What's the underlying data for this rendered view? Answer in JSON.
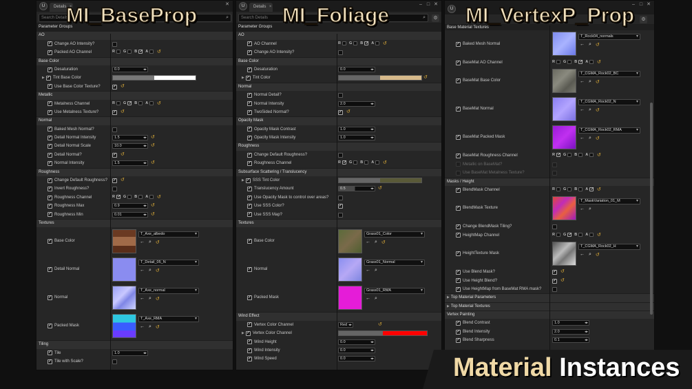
{
  "overlays": {
    "p1": "MI_BaseProp",
    "p2": "MI_Foliage",
    "p3": "MI_VertexP_Prop",
    "banner_w1": "Material",
    "banner_w2": "Instances"
  },
  "chrome": {
    "tab": "Details",
    "search": "Search Details",
    "ue": "U",
    "close": "×",
    "min": "–",
    "max": "□",
    "x": "✕"
  },
  "icons": {
    "search": "⌕",
    "gear": "⚙",
    "arrow": "←",
    "browse": "⌕",
    "reset": "↺",
    "tri": "▶",
    "check": "✓"
  },
  "channels": {
    "r": "R",
    "g": "G",
    "b": "B",
    "a": "A"
  },
  "p1": {
    "header": "Parameter Groups",
    "s_ao": "AO",
    "ao1": "Change AO Intensity?",
    "ao2": "Packed AO Channel",
    "s_bc": "Base Color",
    "bc1": "Desaturation",
    "bc1v": "0.0",
    "bc2": "Tint Base Color",
    "bc3": "Use Base Color Texture?",
    "s_met": "Metallic",
    "met1": "Metalness Channel",
    "met2": "Use Metalness Texture?",
    "s_nor": "Normal",
    "n1": "Baked Mesh Normal?",
    "n2": "Detail Normal Intensity",
    "n2v": "1.5",
    "n3": "Detail Normal Scale",
    "n3v": "10.0",
    "n4": "Detail Normal?",
    "n5": "Normal Intensity",
    "n5v": "1.5",
    "s_rough": "Roughness",
    "r1": "Change Default Roughness?",
    "r2": "Invert Roughness?",
    "r3": "Roughness Channel",
    "r4": "Roughness Max",
    "r4v": "0.9",
    "r5": "Roughness Min",
    "r5v": "0.01",
    "s_tex": "Textures",
    "t1": "Base Color",
    "t1v": "T_Axe_albedo",
    "t2": "Detail Normal",
    "t2v": "T_Detail_05_N",
    "t3": "Normal",
    "t3v": "T_Axe_normal",
    "t4": "Packed Mask",
    "t4v": "T_Axe_RMA",
    "s_til": "Tiling",
    "til1": "Tile",
    "til1v": "1.0",
    "til2": "Tile with Scale?"
  },
  "p2": {
    "header": "Parameter Groups",
    "s_ao": "AO",
    "ao1": "AO Channel",
    "ao2": "Change AO Intensity?",
    "s_bc": "Base Color",
    "bc1": "Desaturation",
    "bc1v": "0.0",
    "bc2": "Tint Color",
    "s_nor": "Normal",
    "n1": "Normal Detail?",
    "n2": "Normal Intensity",
    "n2v": "2.0",
    "n3": "TwoSided Normal?",
    "s_om": "Opacity Mask",
    "om1": "Opacity Mask Contrast",
    "om1v": "1.0",
    "om2": "Opacity Mask Intensity",
    "om2v": "1.0",
    "s_rough": "Roughness",
    "r1": "Change Default Roughness?",
    "r2": "Roughness Channel",
    "s_sss": "Subsurface Scattering / Translucency",
    "sss1": "SSS Tint Color",
    "sss2": "Translucency Amount",
    "sss2v": "0.5",
    "sss3": "Use Opacity Mask to control over areas?",
    "sss4": "Use SSS Color?",
    "sss5": "Use SSS Map?",
    "s_tex": "Textures",
    "t1": "Base Color",
    "t1v": "Grass01_Color",
    "t2": "Normal",
    "t2v": "Grass01_Normal",
    "t3": "Packed Mask",
    "t3v": "Grass01_RMA",
    "s_wind": "Wind Effect",
    "w1": "Vertex Color Channel",
    "w1v": "Red",
    "w2": "Vertex Color Channel",
    "w3": "Wind Height",
    "w3v": "0.0",
    "w4": "Wind Intensity",
    "w4v": "0.0",
    "w5": "Wind Speed",
    "w5v": "0.0"
  },
  "p3": {
    "s_bm": "Base Material Textures",
    "b1": "Baked Mesh Normal",
    "b1v": "T_Rock04_normals",
    "b2": "BaseMat AO Channel",
    "b3": "BaseMat Base Color",
    "b3v": "T_CGMA_Rock02_BC",
    "b4": "BaseMat Normal",
    "b4v": "T_CGMA_Rock02_N",
    "b5": "BaseMat Packed Mask",
    "b5v": "T_CGMA_Rock02_RMA",
    "b6": "BaseMat Roughness Channel",
    "b7": "Metallic on BaseMat?",
    "b8": "Use BaseMat Metalness Texture?",
    "s_mh": "Masks / Height",
    "m1": "BlendMask Channel",
    "m2": "BlendMask Texture",
    "m2v": "T_MaskVariation_01_M",
    "m3": "Change BlendMask Tiling?",
    "m4": "HeightMap Channel",
    "m5": "HeightTexture Mask",
    "m5v": "T_CGMA_Rock02_H",
    "m6": "Use Blend Mask?",
    "m7": "Use Height Blend?",
    "m8": "Use HeightMap from BaseMat RMA mask?",
    "s_tmp": "Top Material Parameters",
    "s_tmt": "Top Material Textures",
    "s_vp": "Vertex Painting",
    "v1": "Blend Contrast",
    "v1v": "1.0",
    "v2": "Blend Intensity",
    "v2v": "2.0",
    "v3": "Blend Sharpness",
    "v3v": "0.1"
  }
}
